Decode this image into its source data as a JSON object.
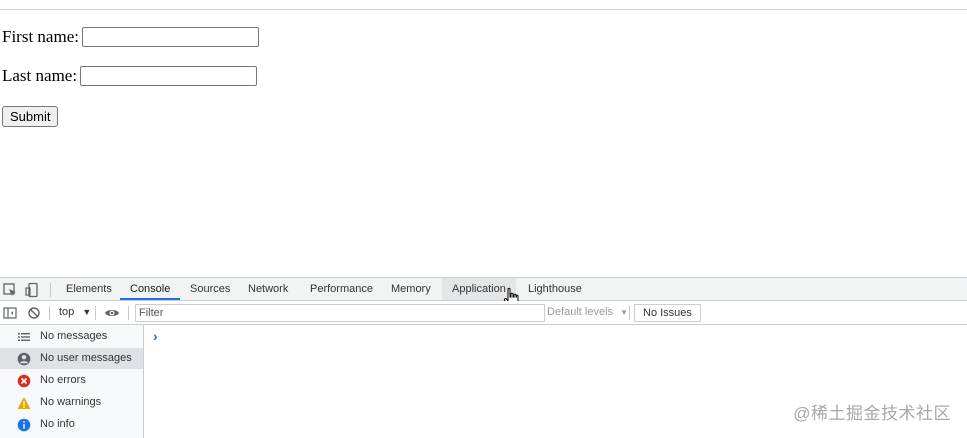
{
  "form": {
    "first_label": "First name:",
    "first_value": "",
    "last_label": "Last name:",
    "last_value": "",
    "submit_label": "Submit"
  },
  "devtools": {
    "tabs": [
      "Elements",
      "Console",
      "Sources",
      "Network",
      "Performance",
      "Memory",
      "Application",
      "Lighthouse"
    ],
    "active_tab": "Console",
    "hovered_tab": "Application",
    "context": "top",
    "filter_placeholder": "Filter",
    "levels_label": "Default levels",
    "issues_label": "No Issues",
    "sidebar": [
      {
        "label": "No messages",
        "icon": "list-icon"
      },
      {
        "label": "No user messages",
        "icon": "user-icon"
      },
      {
        "label": "No errors",
        "icon": "error-icon"
      },
      {
        "label": "No warnings",
        "icon": "warning-icon"
      },
      {
        "label": "No info",
        "icon": "info-icon"
      }
    ],
    "prompt": "›"
  },
  "watermark": "@稀土掘金技术社区",
  "colors": {
    "accent": "#1a73e8",
    "error": "#d93025",
    "warning": "#e8a600",
    "info": "#1a73e8"
  }
}
